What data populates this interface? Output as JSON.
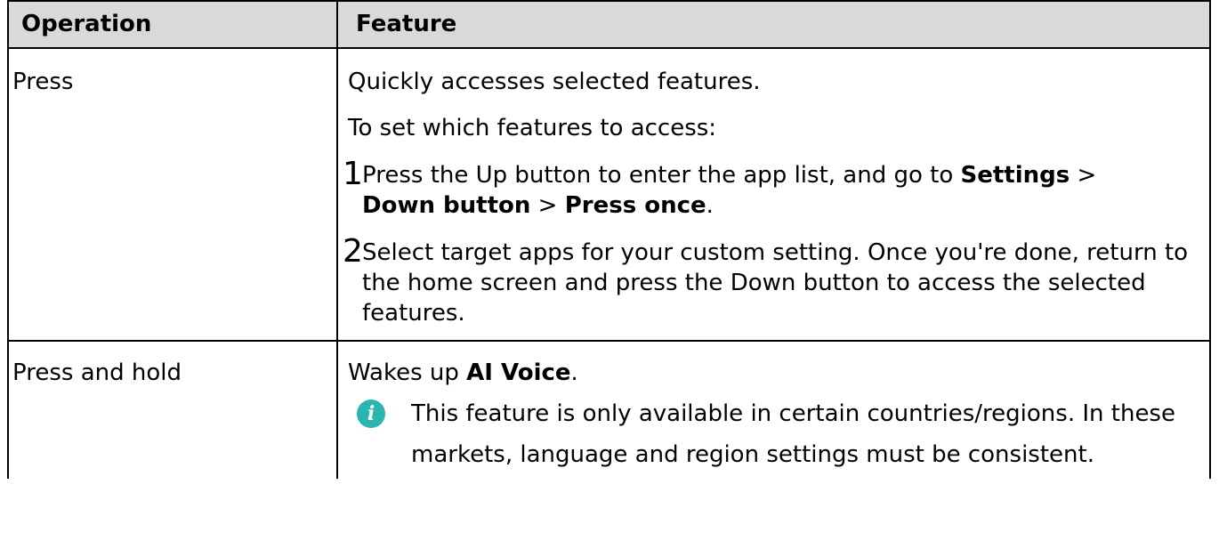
{
  "table": {
    "header": {
      "col1": "Operation",
      "col2": "Feature"
    },
    "rows": [
      {
        "operation": "Press",
        "intro": "Quickly accesses selected features.",
        "setup": "To set which features to access:",
        "steps": [
          {
            "num": "1",
            "text_a": "Press the Up button to enter the app list, and go to ",
            "bold_a": "Settings",
            "sep_a": " > ",
            "bold_b": "Down button",
            "sep_b": " > ",
            "bold_c": "Press once",
            "end": "."
          },
          {
            "num": "2",
            "text": "Select target apps for your custom setting. Once you're done, return to the home screen and press the Down button to access the selected features."
          }
        ]
      },
      {
        "operation": "Press and hold",
        "intro_prefix": "Wakes up ",
        "intro_bold": "AI Voice",
        "intro_suffix": ".",
        "note": {
          "icon": "info-icon",
          "icon_glyph": "i",
          "icon_color": "#2ab5b0",
          "text": "This feature is only available in certain countries/regions. In these markets, language and region settings must be consistent."
        }
      }
    ]
  }
}
